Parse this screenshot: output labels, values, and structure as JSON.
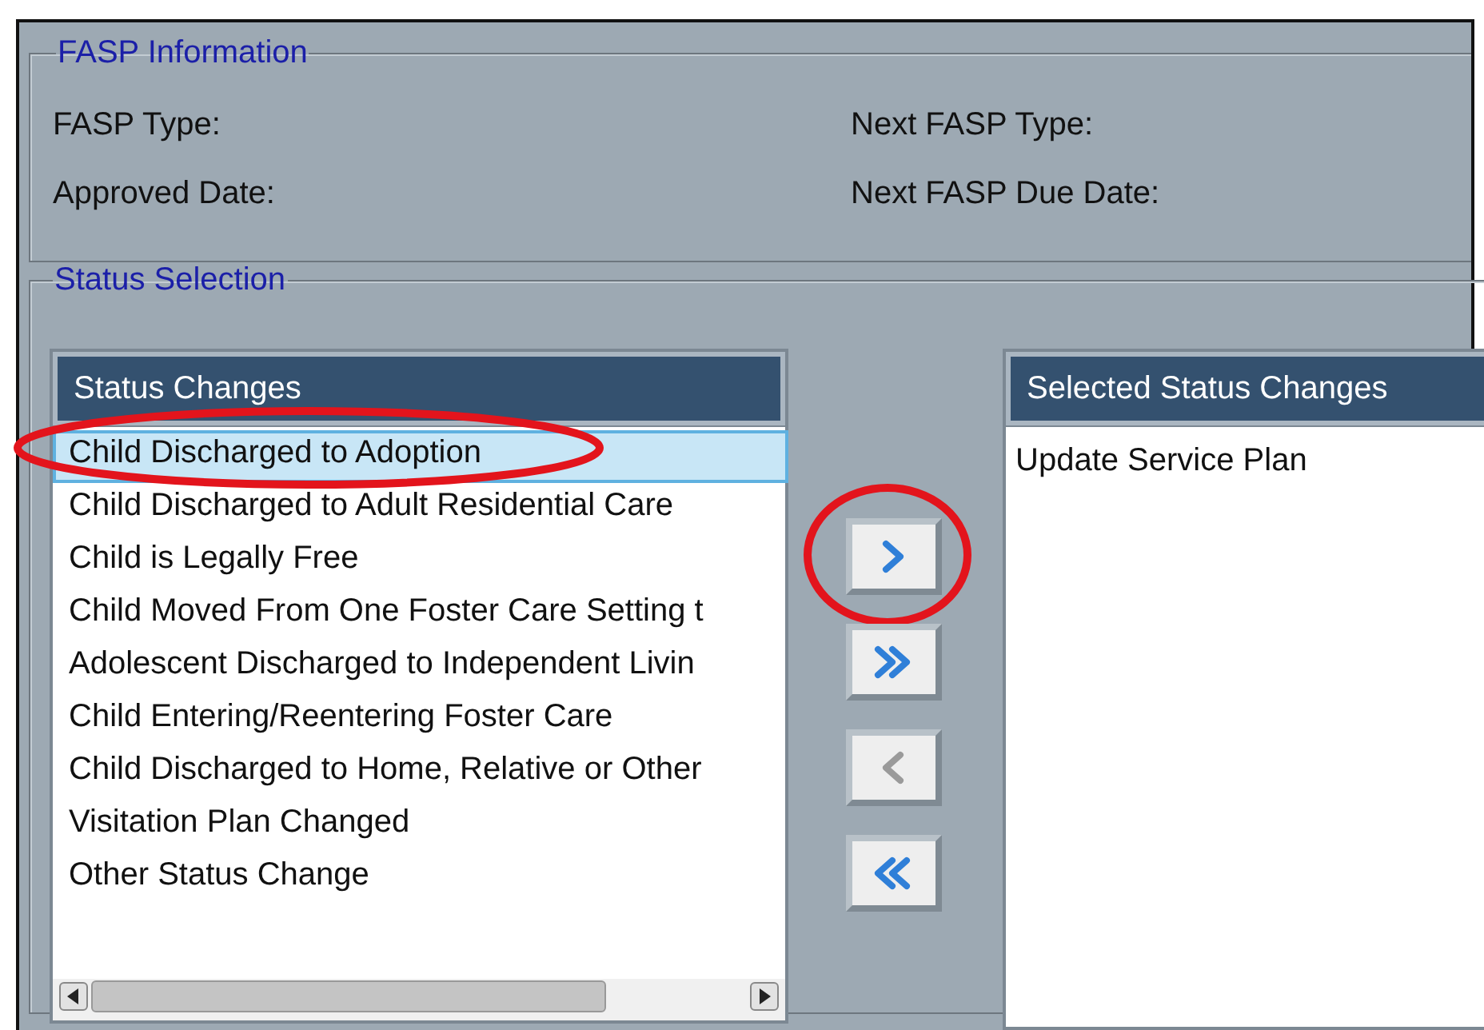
{
  "fasp_information": {
    "legend": "FASP Information",
    "fields": [
      {
        "label": "FASP Type:"
      },
      {
        "label": "Next FASP Type:"
      },
      {
        "label": "Approved Date:"
      },
      {
        "label": "Next FASP Due Date:"
      }
    ]
  },
  "status_selection": {
    "legend": "Status Selection",
    "available": {
      "header": "Status Changes",
      "items": [
        {
          "label": "Child Discharged to Adoption",
          "selected": true,
          "circled": true
        },
        {
          "label": "Child Discharged to Adult Residential Care",
          "selected": false,
          "circled": false
        },
        {
          "label": "Child is Legally Free",
          "selected": false,
          "circled": false
        },
        {
          "label": "Child Moved From One Foster Care Setting t",
          "selected": false,
          "circled": false
        },
        {
          "label": "Adolescent Discharged to Independent Livin",
          "selected": false,
          "circled": false
        },
        {
          "label": "Child Entering/Reentering Foster Care",
          "selected": false,
          "circled": false
        },
        {
          "label": "Child Discharged to Home, Relative or Other",
          "selected": false,
          "circled": false
        },
        {
          "label": "Visitation Plan Changed",
          "selected": false,
          "circled": false
        },
        {
          "label": "Other Status Change",
          "selected": false,
          "circled": false
        }
      ]
    },
    "move_buttons": [
      {
        "kind": "add",
        "disabled": false,
        "circled": true
      },
      {
        "kind": "add_all",
        "disabled": false,
        "circled": false
      },
      {
        "kind": "remove",
        "disabled": true,
        "circled": false
      },
      {
        "kind": "remove_all",
        "disabled": false,
        "circled": false
      }
    ],
    "selected": {
      "header": "Selected Status Changes",
      "items": [
        {
          "label": "Update Service Plan",
          "selected": false
        }
      ]
    }
  }
}
